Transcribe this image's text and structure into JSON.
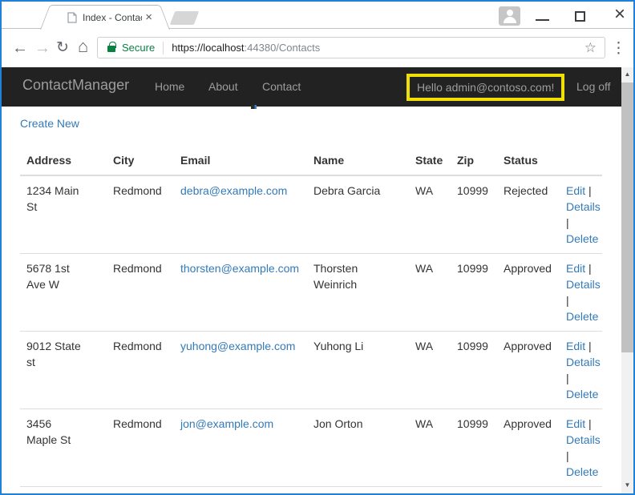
{
  "browser": {
    "tab_title": "Index - ContactManager",
    "security_label": "Secure",
    "url_host": "https://localhost",
    "url_path": ":44380/Contacts"
  },
  "icons": {
    "back": "←",
    "forward": "→",
    "reload": "↻",
    "home": "⌂",
    "star": "☆",
    "menu": "⋮",
    "tab_close": "×",
    "window_close": "×",
    "scroll_up": "▲",
    "scroll_down": "▼"
  },
  "navbar": {
    "brand": "ContactManager",
    "links": [
      "Home",
      "About",
      "Contact"
    ],
    "greeting": "Hello admin@contoso.com!",
    "logoff": "Log off"
  },
  "page": {
    "create_new": "Create New"
  },
  "table": {
    "headers": [
      "Address",
      "City",
      "Email",
      "Name",
      "State",
      "Zip",
      "Status",
      ""
    ],
    "actions": {
      "edit": "Edit",
      "details": "Details",
      "delete": "Delete",
      "separator": "|"
    },
    "rows": [
      {
        "address": "1234 Main St",
        "city": "Redmond",
        "email": "debra@example.com",
        "name": "Debra Garcia",
        "state": "WA",
        "zip": "10999",
        "status": "Rejected"
      },
      {
        "address": "5678 1st Ave W",
        "city": "Redmond",
        "email": "thorsten@example.com",
        "name": "Thorsten Weinrich",
        "state": "WA",
        "zip": "10999",
        "status": "Approved"
      },
      {
        "address": "9012 State st",
        "city": "Redmond",
        "email": "yuhong@example.com",
        "name": "Yuhong Li",
        "state": "WA",
        "zip": "10999",
        "status": "Approved"
      },
      {
        "address": "3456 Maple St",
        "city": "Redmond",
        "email": "jon@example.com",
        "name": "Jon Orton",
        "state": "WA",
        "zip": "10999",
        "status": "Approved"
      }
    ]
  },
  "colors": {
    "window_border": "#1f82d8",
    "navbar_bg": "#222222",
    "navbar_text": "#9d9d9d",
    "link_blue": "#337ab7",
    "secure_green": "#0b8043",
    "highlight_yellow": "#efdf06",
    "table_border": "#dddddd"
  }
}
